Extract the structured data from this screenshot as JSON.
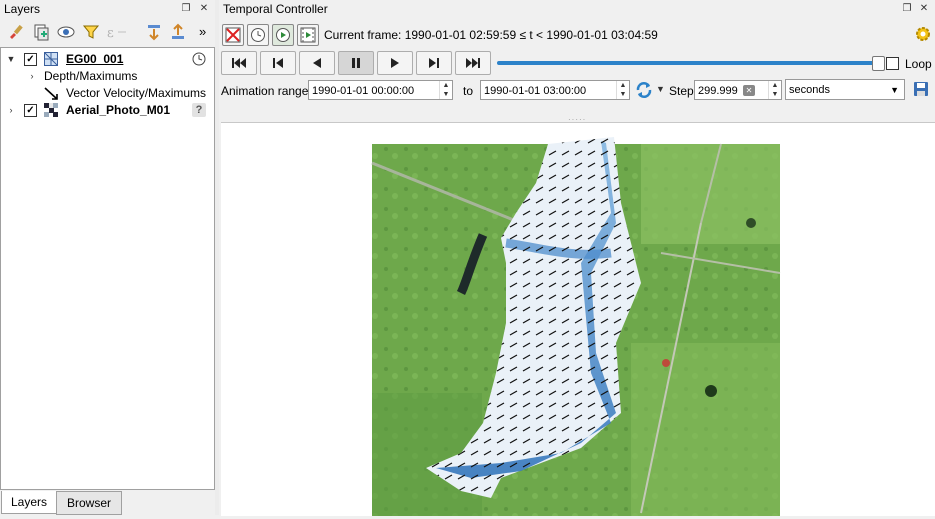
{
  "layers_panel": {
    "title": "Layers",
    "toolbar_icons": [
      "paintbrush-icon",
      "add-group-icon",
      "eye-icon",
      "filter-icon",
      "expression-filter-icon",
      "expand-all-icon",
      "collapse-all-icon",
      "more-icon"
    ],
    "more_label": "»",
    "tree": [
      {
        "label": "EG00_001",
        "checked": true,
        "expanded": true,
        "icon": "mesh-layer-icon",
        "trailing_icon": "clock-icon"
      },
      {
        "label": "Depth/Maximums",
        "level": 1,
        "collapsed": true
      },
      {
        "label": "Vector Velocity/Maximums",
        "level": 1,
        "icon": "vector-arrow-icon"
      },
      {
        "label": "Aerial_Photo_M01",
        "checked": true,
        "icon": "raster-layer-icon",
        "trailing_icon": "question-icon"
      }
    ],
    "tabs": [
      "Layers",
      "Browser"
    ],
    "active_tab": "Layers"
  },
  "temporal_controller": {
    "title": "Temporal Controller",
    "current_frame_prefix": "Current frame: ",
    "current_frame_text": "1990-01-01 02:59:59 ≤ t < 1990-01-01 03:04:59",
    "playback_buttons": [
      "skip-to-start",
      "step-back",
      "play-reverse",
      "pause",
      "play",
      "step-forward",
      "skip-to-end"
    ],
    "slider_value": 1.0,
    "loop_label": "Loop",
    "loop_checked": false,
    "range_label": "Animation range",
    "range_start": "1990-01-01 00:00:00",
    "to_label": "to",
    "range_end": "1990-01-01 03:00:00",
    "step_label": "Step",
    "step_value": "299.999",
    "step_unit": "seconds",
    "accent_color": "#2c82c9"
  }
}
